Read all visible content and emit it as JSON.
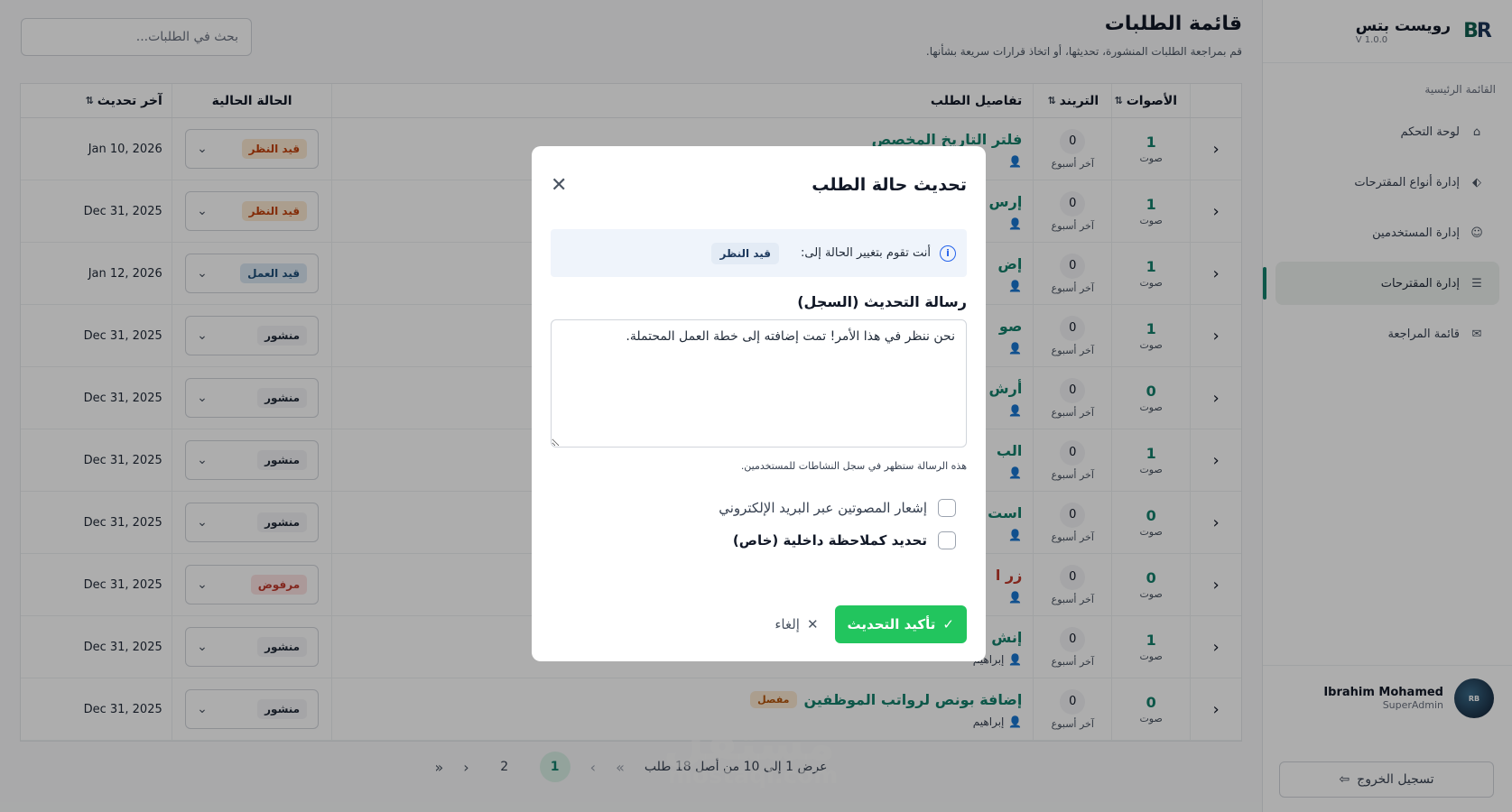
{
  "brand": {
    "name": "رويست بتس",
    "version": "V 1.0.0",
    "logo_text": "RB"
  },
  "sidebar": {
    "section_label": "القائمة الرئيسية",
    "items": [
      {
        "label": "لوحة التحكم",
        "icon": "home-icon"
      },
      {
        "label": "إدارة أنواع المقترحات",
        "icon": "tag-icon"
      },
      {
        "label": "إدارة المستخدمين",
        "icon": "users-icon"
      },
      {
        "label": "إدارة المقترحات",
        "icon": "list-icon",
        "active": true
      },
      {
        "label": "قائمة المراجعة",
        "icon": "inbox-icon"
      }
    ],
    "user": {
      "name": "Ibrahim Mohamed",
      "role": "SuperAdmin"
    },
    "logout_label": "تسجيل الخروج"
  },
  "header": {
    "title": "قائمة الطلبات",
    "subtitle": "قم بمراجعة الطلبات المنشورة، تحديثها، أو اتخاذ قرارات سريعة بشأنها.",
    "search_placeholder": "بحث في الطلبات..."
  },
  "table": {
    "columns": {
      "votes": "الأصوات",
      "trend": "التريند",
      "details": "تفاصيل الطلب",
      "status": "الحالة الحالية",
      "updated": "آخر تحديث"
    },
    "votes_unit": "صوت",
    "trend_unit": "آخر أسبوع",
    "rows": [
      {
        "votes": "1",
        "trend": "0",
        "title": "فلتر التاريخ المخصص",
        "title_color": "green",
        "badge": "",
        "author": "",
        "status": "قيد النظر",
        "status_kind": "review",
        "updated": "Jan 10, 2026"
      },
      {
        "votes": "1",
        "trend": "0",
        "title": "إرس",
        "title_color": "green",
        "badge": "",
        "author": "",
        "status": "قيد النظر",
        "status_kind": "review",
        "updated": "Dec 31, 2025"
      },
      {
        "votes": "1",
        "trend": "0",
        "title": "إض",
        "title_color": "green",
        "badge": "",
        "author": "",
        "status": "قيد العمل",
        "status_kind": "work",
        "updated": "Jan 12, 2026"
      },
      {
        "votes": "1",
        "trend": "0",
        "title": "صو",
        "title_color": "green",
        "badge": "",
        "author": "",
        "status": "منشور",
        "status_kind": "published",
        "updated": "Dec 31, 2025"
      },
      {
        "votes": "0",
        "trend": "0",
        "title": "أرش",
        "title_color": "green",
        "badge": "",
        "author": "",
        "status": "منشور",
        "status_kind": "published",
        "updated": "Dec 31, 2025"
      },
      {
        "votes": "1",
        "trend": "0",
        "title": "الب",
        "title_color": "green",
        "badge": "",
        "author": "",
        "status": "منشور",
        "status_kind": "published",
        "updated": "Dec 31, 2025"
      },
      {
        "votes": "0",
        "trend": "0",
        "title": "است",
        "title_color": "green",
        "badge": "",
        "author": "",
        "status": "منشور",
        "status_kind": "published",
        "updated": "Dec 31, 2025"
      },
      {
        "votes": "0",
        "trend": "0",
        "title": "زر ا",
        "title_color": "red",
        "badge": "",
        "author": "",
        "status": "مرفوض",
        "status_kind": "rejected",
        "updated": "Dec 31, 2025"
      },
      {
        "votes": "1",
        "trend": "0",
        "title": "إنش",
        "title_color": "green",
        "badge": "",
        "author": "إبراهيم",
        "status": "منشور",
        "status_kind": "published",
        "updated": "Dec 31, 2025"
      },
      {
        "votes": "0",
        "trend": "0",
        "title": "إضافة بونص لرواتب الموظفين",
        "title_color": "green",
        "badge": "مفصل",
        "author": "إبراهيم",
        "status": "منشور",
        "status_kind": "published",
        "updated": "Dec 31, 2025"
      }
    ]
  },
  "pagination": {
    "summary": "عرض 1 إلى 10 من أصل 18 طلب",
    "pages": [
      "1",
      "2"
    ],
    "current": "1"
  },
  "modal": {
    "title": "تحديث حالة الطلب",
    "info_text": "أنت تقوم بتغيير الحالة إلى:",
    "info_status": "قيد النظر",
    "message_label": "رسالة التحديث (السجل)",
    "message_value": "نحن ننظر في هذا الأمر! تمت إضافته إلى خطة العمل المحتملة.",
    "helper": "هذه الرسالة ستظهر في سجل النشاطات للمستخدمين.",
    "checkbox_notify": "إشعار المصوتين عبر البريد الإلكتروني",
    "checkbox_internal": "تحديد كملاحظة داخلية (خاص)",
    "confirm_label": "تأكيد التحديث",
    "cancel_label": "إلغاء"
  },
  "watermark": {
    "text": "مستقل",
    "sub": "mostaql.com"
  }
}
